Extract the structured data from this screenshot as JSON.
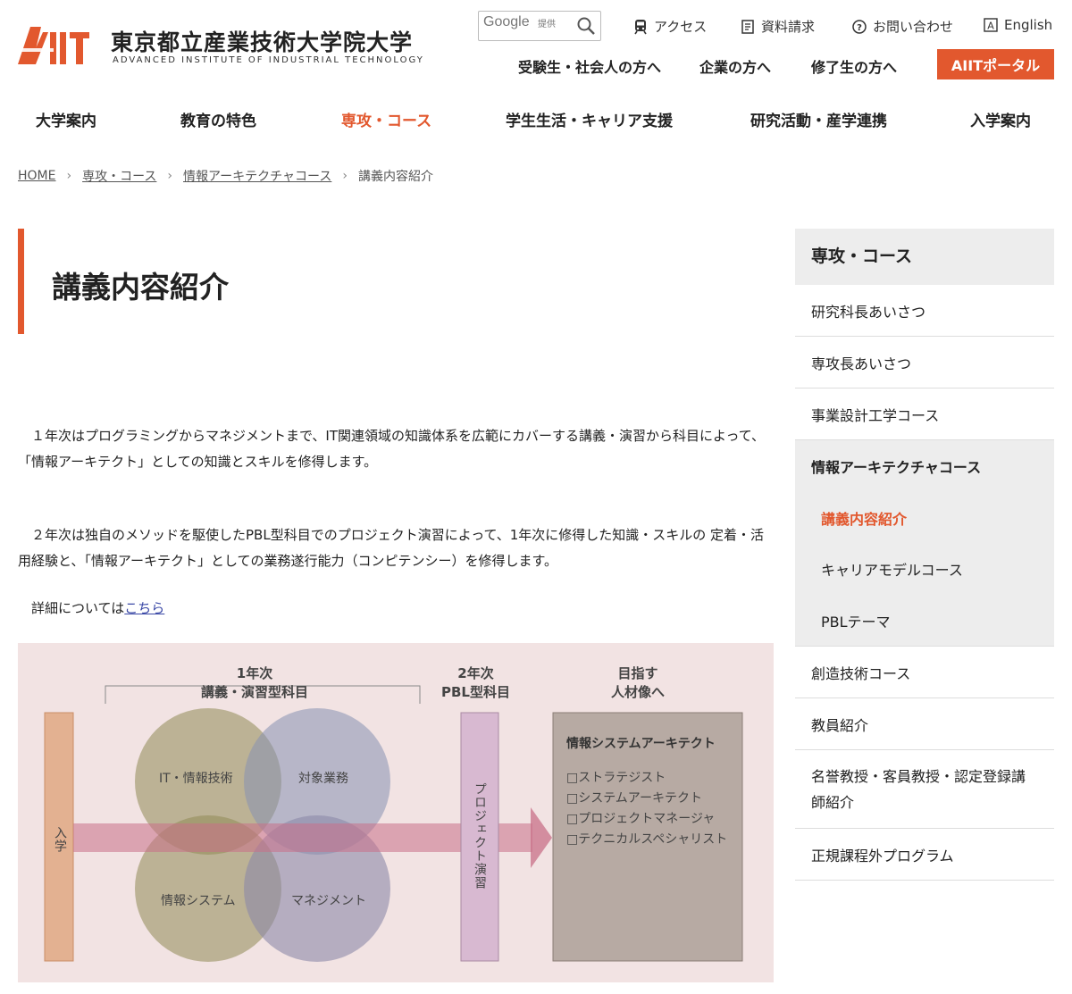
{
  "header": {
    "logo_jp": "東京都立産業技術大学院大学",
    "logo_en": "ADVANCED INSTITUTE OF INDUSTRIAL TECHNOLOGY",
    "logo_mark_text": "AIIT",
    "search": {
      "provider": "Google",
      "provided": "提供"
    },
    "utility": {
      "access": "アクセス",
      "request": "資料請求",
      "contact": "お問い合わせ",
      "english": "English"
    },
    "audience": [
      "受験生・社会人の方へ",
      "企業の方へ",
      "修了生の方へ"
    ],
    "portal": "AIITポータル",
    "nav": [
      "大学案内",
      "教育の特色",
      "専攻・コース",
      "学生生活・キャリア支援",
      "研究活動・産学連携",
      "入学案内"
    ],
    "accent_color": "#e2582e"
  },
  "breadcrumb": [
    "HOME",
    "専攻・コース",
    "情報アーキテクチャコース",
    "講義内容紹介"
  ],
  "page": {
    "title": "講義内容紹介",
    "para1": "１年次はプログラミングからマネジメントまで、IT関連領域の知識体系を広範にカバーする講義・演習から科目によって、「情報アーキテクト」としての知識とスキルを修得します。",
    "para2": "２年次は独自のメソッドを駆使したPBL型科目でのプロジェクト演習によって、1年次に修得した知識・スキルの 定着・活用経験と、「情報アーキテクト」としての業務遂行能力（コンピテンシー）を修得します。",
    "more_prefix": "詳細については",
    "more_link": "こちら"
  },
  "diagram": {
    "year1_line1": "1年次",
    "year1_line2": "講義・演習型科目",
    "year2_line1": "2年次",
    "year2_line2": "PBL型科目",
    "goal_line1": "目指す",
    "goal_line2": "人材像へ",
    "entry": "入学",
    "circles": [
      "IT・情報技術",
      "対象業務",
      "情報システム",
      "マネジメント"
    ],
    "pbl": "プロジェクト演習",
    "goal_title": "情報システムアーキテクト",
    "goal_items": [
      "□ストラテジスト",
      "□システムアーキテクト",
      "□プロジェクトマネージャ",
      "□テクニカルスペシャリスト"
    ]
  },
  "sidebar": {
    "heading": "専攻・コース",
    "items_top": [
      "研究科長あいさつ",
      "専攻長あいさつ",
      "事業設計工学コース"
    ],
    "group_title": "情報アーキテクチャコース",
    "group_items": [
      "講義内容紹介",
      "キャリアモデルコース",
      "PBLテーマ"
    ],
    "items_bottom": [
      "創造技術コース",
      "教員紹介",
      "名誉教授・客員教授・認定登録講師紹介",
      "正規課程外プログラム"
    ]
  }
}
